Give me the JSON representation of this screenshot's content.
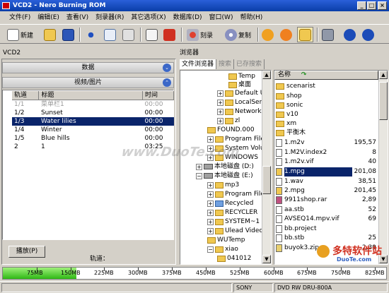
{
  "window": {
    "title": "VCD2 - Nero Burning ROM",
    "controls": [
      "_",
      "□",
      "×"
    ]
  },
  "menu": [
    "文件(F)",
    "编辑(E)",
    "查看(V)",
    "刻录器(R)",
    "其它选项(X)",
    "数据库(D)",
    "窗口(W)",
    "帮助(H)"
  ],
  "toolbar": {
    "new_label": "新建",
    "burn_label": "刻录",
    "copy_label": "复制"
  },
  "left_panel": {
    "title": "VCD2",
    "section_data": "数据",
    "section_video": "视频/图片",
    "columns": [
      "轨道",
      "标题",
      "时间"
    ],
    "rows": [
      [
        "1/1",
        "菜单栏1",
        "00:00"
      ],
      [
        "1/2",
        "Sunset",
        "00:00"
      ],
      [
        "1/3",
        "Water lilies",
        "00:00"
      ],
      [
        "1/4",
        "Winter",
        "00:00"
      ],
      [
        "1/5",
        "Blue hills",
        "00:00"
      ],
      [
        "2",
        "1",
        "03:25"
      ]
    ],
    "play_button": "播放(P)",
    "track_label": "轨道："
  },
  "browser": {
    "title": "浏览器",
    "tabs": [
      "文件浏览器",
      "搜索",
      "已存搜索"
    ],
    "tree": [
      "Temp",
      "桌面",
      "Default U",
      "LocalServ",
      "NetworkS",
      "zl",
      "FOUND.000",
      "Program Files",
      "System Volum",
      "WINDOWS",
      "本地磁盘 (D:)",
      "本地磁盘 (E:)",
      "mp3",
      "Program Files",
      "Recycled",
      "RECYCLER",
      "SYSTEM~1",
      "Ulead VideoSt",
      "WUTemp",
      "xiao",
      "041012"
    ],
    "list_header": "名称",
    "files": [
      {
        "name": "scenarist",
        "size": ""
      },
      {
        "name": "shop",
        "size": ""
      },
      {
        "name": "sonic",
        "size": ""
      },
      {
        "name": "v10",
        "size": ""
      },
      {
        "name": "xm",
        "size": ""
      },
      {
        "name": "平衡木",
        "size": ""
      },
      {
        "name": "1.m2v",
        "size": "195,57"
      },
      {
        "name": "1.M2V.index2",
        "size": "8"
      },
      {
        "name": "1.m2v.vif",
        "size": "40"
      },
      {
        "name": "1.mpg",
        "size": "201,08"
      },
      {
        "name": "1.wav",
        "size": "38,51"
      },
      {
        "name": "2.mpg",
        "size": "201,45"
      },
      {
        "name": "9911shop.rar",
        "size": "2,89"
      },
      {
        "name": "aa.stb",
        "size": "52"
      },
      {
        "name": "AVSEQ14.mpv.vif",
        "size": "69"
      },
      {
        "name": "bb.project",
        "size": ""
      },
      {
        "name": "bb.stb",
        "size": "25"
      },
      {
        "name": "buyok3.zip",
        "size": "2,39"
      }
    ]
  },
  "capacity": {
    "used_mb": 163,
    "scale_max_mb": 850,
    "ticks": [
      "75MB",
      "150MB",
      "225MB",
      "300MB",
      "375MB",
      "450MB",
      "525MB",
      "600MB",
      "675MB",
      "750MB",
      "825MB"
    ]
  },
  "status": {
    "drive_vendor": "SONY",
    "drive_model": "DVD RW DRU-800A"
  },
  "watermark": "www.DuoTe.com",
  "logo": {
    "text": "多特软件站",
    "url_text": "DuoTe.com"
  },
  "colors": {
    "selection": "#0a246a",
    "title_bar": "#0a3ea8",
    "capacity_fill": "#2eb814",
    "folder": "#f0c850"
  }
}
